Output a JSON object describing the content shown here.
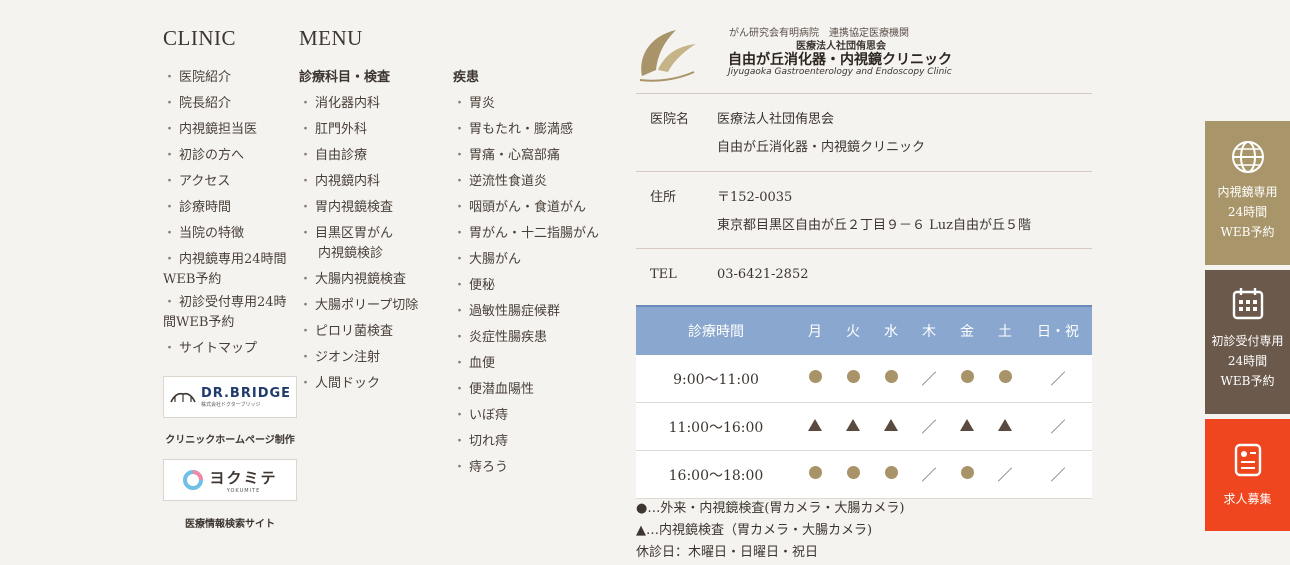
{
  "clinic": {
    "heading": "CLINIC",
    "items": [
      "医院紹介",
      "院長紹介",
      "内視鏡担当医",
      "初診の方へ",
      "アクセス",
      "診療時間",
      "当院の特徴"
    ],
    "wrap_items": [
      {
        "line1": "内視鏡専用24時間",
        "line2": "WEB予約"
      },
      {
        "line1": "初診受付専用24時",
        "line2": "間WEB予約"
      }
    ],
    "last_item": "サイトマップ",
    "banner1": {
      "text": "DR.BRIDGE",
      "sub": "株式会社ドクターブリッジ",
      "caption": "クリニックホームページ制作"
    },
    "banner2": {
      "text": "ヨクミテ",
      "sub": "YOKUMITE",
      "caption": "医療情報検索サイト"
    }
  },
  "menu": {
    "heading": "MENU",
    "subhead": "診療科目・検査",
    "items": [
      "消化器内科",
      "肛門外科",
      "自由診療",
      "内視鏡内科",
      "胃内視鏡検査"
    ],
    "wrap_item": {
      "line1": "目黒区胃がん",
      "line2": "内視鏡検診"
    },
    "items2": [
      "大腸内視鏡検査",
      "大腸ポリープ切除",
      "ピロリ菌検査",
      "ジオン注射",
      "人間ドック"
    ]
  },
  "disease": {
    "subhead": "疾患",
    "items": [
      "胃炎",
      "胃もたれ・膨満感",
      "胃痛・心窩部痛",
      "逆流性食道炎",
      "咽頭がん・食道がん",
      "胃がん・十二指腸がん",
      "大腸がん",
      "便秘",
      "過敏性腸症候群",
      "炎症性腸疾患",
      "血便",
      "便潜血陽性",
      "いぼ痔",
      "切れ痔",
      "痔ろう"
    ]
  },
  "logo": {
    "line1": "がん研究会有明病院　連携協定医療機関",
    "line2": "医療法人社団侑思会",
    "line3": "自由が丘消化器・内視鏡クリニック",
    "line4": "Jiyugaoka Gastroenterology and Endoscopy Clinic",
    "color": "#a89468"
  },
  "info": {
    "name_label": "医院名",
    "name_line1": "医療法人社団侑思会",
    "name_line2": "自由が丘消化器・内視鏡クリニック",
    "address_label": "住所",
    "postal": "〒152-0035",
    "address": "東京都目黒区自由が丘２丁目９－６ Luz自由が丘５階",
    "tel_label": "TEL",
    "tel": "03-6421-2852"
  },
  "schedule": {
    "header": [
      "診療時間",
      "月",
      "火",
      "水",
      "木",
      "金",
      "土",
      "日・祝"
    ],
    "rows": [
      {
        "time": "9:00〜11:00",
        "marks": [
          "circle",
          "circle",
          "circle",
          "slash",
          "circle",
          "circle",
          "slash"
        ]
      },
      {
        "time": "11:00〜16:00",
        "marks": [
          "triangle",
          "triangle",
          "triangle",
          "slash",
          "triangle",
          "triangle",
          "slash"
        ]
      },
      {
        "time": "16:00〜18:00",
        "marks": [
          "circle",
          "circle",
          "circle",
          "slash",
          "circle",
          "slash",
          "slash"
        ]
      }
    ],
    "legend1": "●…外来・内視鏡検査(胃カメラ・大腸カメラ)",
    "legend2": "▲…内視鏡検査（胃カメラ・大腸カメラ)",
    "legend3": "休診日：木曜日・日曜日・祝日",
    "header_color": "#8aa7cf"
  },
  "side": {
    "btn1": {
      "lines": [
        "内視鏡専用",
        "24時間",
        "WEB予約"
      ],
      "icon": "globe-icon",
      "color": "#a8966a"
    },
    "btn2": {
      "lines": [
        "初診受付専用",
        "24時間",
        "WEB予約"
      ],
      "icon": "calendar-icon",
      "color": "#6b5a4c"
    },
    "btn3": {
      "lines": [
        "求人募集"
      ],
      "icon": "document-icon",
      "color": "#f0461f"
    }
  }
}
